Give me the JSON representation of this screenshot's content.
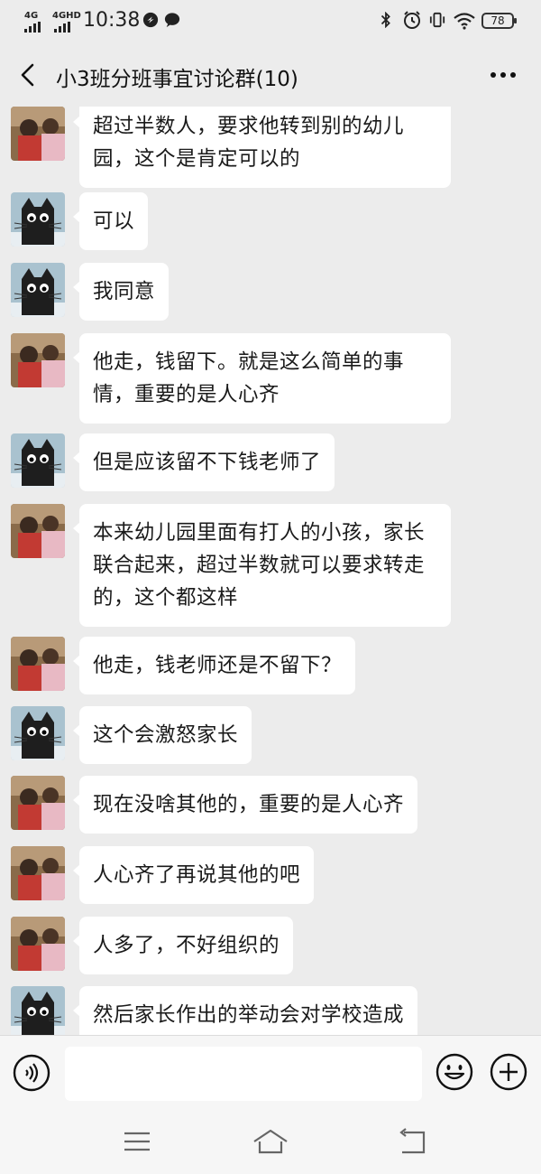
{
  "status_bar": {
    "net1": "4G",
    "net2": "4GHD",
    "time": "10:38",
    "battery": "78"
  },
  "header": {
    "title": "小3班分班事宜讨论群(10)"
  },
  "messages": [
    {
      "sender": "kids-photo",
      "text": "超过半数人，要求他转到别的幼儿园，这个是肯定可以的"
    },
    {
      "sender": "cat",
      "text": "可以"
    },
    {
      "sender": "cat",
      "text": "我同意"
    },
    {
      "sender": "kids-photo",
      "text": "他走，钱留下。就是这么简单的事情，重要的是人心齐"
    },
    {
      "sender": "cat",
      "text": "但是应该留不下钱老师了"
    },
    {
      "sender": "kids-photo",
      "text": "本来幼儿园里面有打人的小孩，家长联合起来，超过半数就可以要求转走的，这个都这样"
    },
    {
      "sender": "kids-photo",
      "text": "他走，钱老师还是不留下？"
    },
    {
      "sender": "cat",
      "text": "这个会激怒家长"
    },
    {
      "sender": "kids-photo",
      "text": "现在没啥其他的，重要的是人心齐"
    },
    {
      "sender": "kids-photo",
      "text": "人心齐了再说其他的吧"
    },
    {
      "sender": "kids-photo",
      "text": "人多了，不好组织的"
    },
    {
      "sender": "cat",
      "text": "然后家长作出的举动会对学校造成"
    }
  ],
  "input": {
    "placeholder": "",
    "value": ""
  },
  "colors": {
    "background": "#ececec",
    "bubble": "#ffffff",
    "text": "#1a1a1a"
  },
  "icons": [
    "back-arrow-icon",
    "more-dots-icon",
    "voice-icon",
    "emoji-icon",
    "plus-icon",
    "menu-icon",
    "home-icon",
    "return-icon"
  ]
}
